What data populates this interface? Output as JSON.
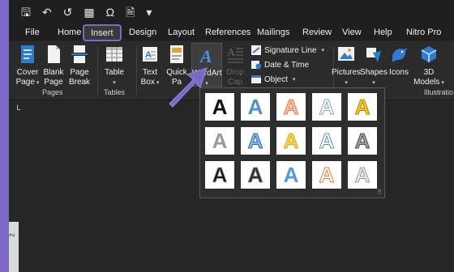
{
  "qat": {
    "icons": [
      "save-icon",
      "undo-icon",
      "redo-icon",
      "table-icon",
      "omega-icon",
      "document-icon",
      "customize-icon"
    ],
    "glyphs": [
      "🖫",
      "↶",
      "↺",
      "▦",
      "Ω",
      "🗎",
      "▾"
    ]
  },
  "tabs": [
    {
      "label": "File",
      "active": false
    },
    {
      "label": "Home",
      "active": false
    },
    {
      "label": "Insert",
      "active": true
    },
    {
      "label": "Design",
      "active": false
    },
    {
      "label": "Layout",
      "active": false
    },
    {
      "label": "References",
      "active": false
    },
    {
      "label": "Mailings",
      "active": false
    },
    {
      "label": "Review",
      "active": false
    },
    {
      "label": "View",
      "active": false
    },
    {
      "label": "Help",
      "active": false
    },
    {
      "label": "Nitro Pro",
      "active": false
    }
  ],
  "ribbon": {
    "cover_page": {
      "line1": "Cover",
      "line2": "Page"
    },
    "blank_page": {
      "line1": "Blank",
      "line2": "Page"
    },
    "page_break": {
      "line1": "Page",
      "line2": "Break"
    },
    "table": {
      "line1": "Table"
    },
    "text_box": {
      "line1": "Text",
      "line2": "Box"
    },
    "quick_parts": {
      "line1": "Quick",
      "line2": "Pa"
    },
    "wordart": {
      "line1": "WordArt"
    },
    "drop_cap": {
      "line1": "Drop",
      "line2": "Cap"
    },
    "signature_line": "Signature Line",
    "date_time": "Date & Time",
    "object": "Object",
    "pictures": {
      "line1": "Pictures"
    },
    "shapes": {
      "line1": "Shapes"
    },
    "icons": {
      "line1": "Icons"
    },
    "models_3d": {
      "line1": "3D",
      "line2": "Models"
    },
    "groups": {
      "pages": "Pages",
      "tables": "Tables",
      "illustrations": "Illustratio"
    }
  },
  "document": {
    "ruler_corner": "L",
    "vertical_ruler_number": "2"
  },
  "gallery": {
    "sample_text": "A",
    "styles": [
      {
        "name": "wordart-style-1",
        "fill": "#111111",
        "stroke": "none"
      },
      {
        "name": "wordart-style-2",
        "fill": "#4a90d9",
        "stroke": "none"
      },
      {
        "name": "wordart-style-3",
        "fill": "#f4c2a8",
        "stroke": "#e07a4a"
      },
      {
        "name": "wordart-style-4",
        "fill": "#ffffff",
        "stroke": "#7aa6d6"
      },
      {
        "name": "wordart-style-5",
        "fill": "#f5c518",
        "stroke": "#b8860b"
      },
      {
        "name": "wordart-style-6",
        "fill": "#9a9a9a",
        "stroke": "none"
      },
      {
        "name": "wordart-style-7",
        "fill": "#7fb8e8",
        "stroke": "#2f6fb0"
      },
      {
        "name": "wordart-style-8",
        "fill": "#f8d24a",
        "stroke": "#e6a817"
      },
      {
        "name": "wordart-style-9",
        "fill": "#ffffff",
        "stroke": "#5a8fc8"
      },
      {
        "name": "wordart-style-10",
        "fill": "#9a9a9a",
        "stroke": "#555555"
      },
      {
        "name": "wordart-style-11",
        "fill": "#111111",
        "stroke": "#aaaaaa"
      },
      {
        "name": "wordart-style-12",
        "fill": "#2a2a2a",
        "stroke": "#888888"
      },
      {
        "name": "wordart-style-13",
        "fill": "#4f9be0",
        "stroke": "none"
      },
      {
        "name": "wordart-style-14",
        "fill": "#ffffff",
        "stroke": "#e07a30"
      },
      {
        "name": "wordart-style-15",
        "fill": "#e6e6e6",
        "stroke": "#9a9a9a"
      }
    ]
  },
  "colors": {
    "accent": "#7b68c7",
    "ribbon_bg": "#2b2b2b",
    "doc_bg": "#262626",
    "wordart_icon": "#4a8fe0"
  }
}
